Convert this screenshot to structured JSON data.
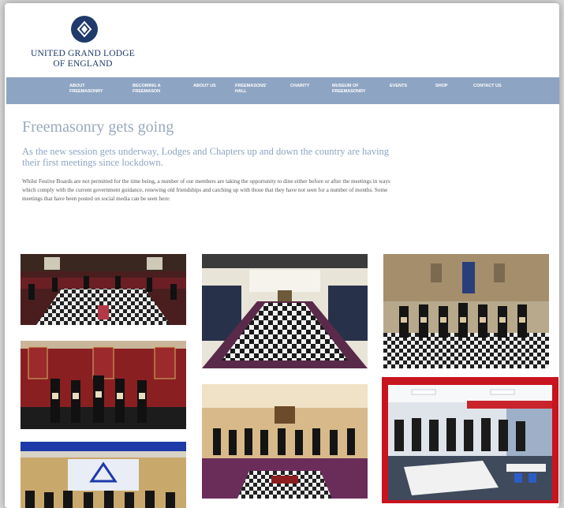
{
  "logo": {
    "line1": "UNITED GRAND LODGE",
    "line2": "OF ENGLAND",
    "icon": "compass-square-icon"
  },
  "nav": {
    "items": [
      {
        "label": "ABOUT FREEMASONRY"
      },
      {
        "label": "BECOMING A FREEMASON"
      },
      {
        "label": "ABOUT US"
      },
      {
        "label": "FREEMASONS' HALL"
      },
      {
        "label": "CHARITY"
      },
      {
        "label": "MUSEUM OF FREEMASONRY"
      },
      {
        "label": "EVENTS"
      },
      {
        "label": "SHOP"
      },
      {
        "label": "CONTACT US"
      }
    ]
  },
  "article": {
    "title": "Freemasonry gets going",
    "lead": "As the new session gets underway, Lodges and Chapters up and down the country are having their first meetings since lockdown.",
    "body": "Whilst Festive Boards are not permitted for the time being, a number of our members are taking the opportunity to dine either before or after the meetings in ways which comply with the current government guidance, renewing old friendships and catching up with those that they have not seen for a number of months. Some meetings that have been posted on social media can be seen here:"
  },
  "colors": {
    "nav_bg": "#8ea4c3",
    "title": "#9aa9c0",
    "brand": "#1f3a6b",
    "highlight_frame": "#c8141e"
  }
}
